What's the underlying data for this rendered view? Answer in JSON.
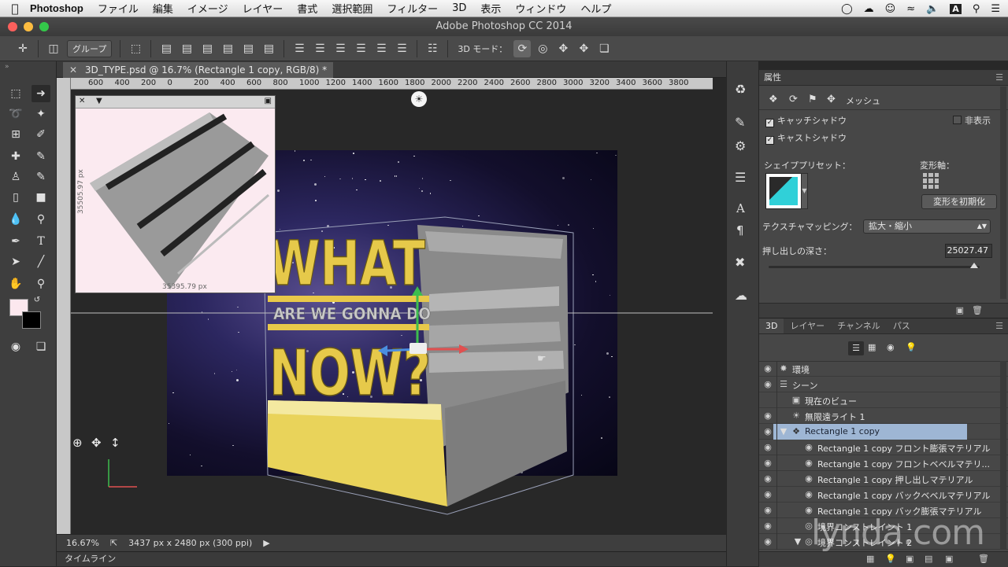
{
  "menubar": {
    "app_name": "Photoshop",
    "items": [
      "ファイル",
      "編集",
      "イメージ",
      "レイヤー",
      "書式",
      "選択範囲",
      "フィルター",
      "3D",
      "表示",
      "ウィンドウ",
      "ヘルプ"
    ],
    "status_letter": "A"
  },
  "window": {
    "title": "Adobe Photoshop CC 2014"
  },
  "options": {
    "group_select": "グループ",
    "mode_3d_label": "3D モード："
  },
  "document": {
    "tab_title": "3D_TYPE.psd @ 16.7% (Rectangle 1 copy, RGB/8) *",
    "ruler_numbers": [
      "600",
      "400",
      "200",
      "0",
      "200",
      "400",
      "600",
      "800",
      "1000",
      "1200",
      "1400",
      "1600",
      "1800",
      "2000",
      "2200",
      "2400",
      "2600",
      "2800",
      "3000",
      "3200",
      "3400",
      "3600",
      "3800"
    ],
    "nav_dim_vertical": "35505.97 px",
    "nav_dim_horizontal": "35395.79 px",
    "scene_text_line1": "WHAT",
    "scene_text_line2": "ARE WE GONNA DO",
    "scene_text_line3": "NOW?"
  },
  "status": {
    "zoom": "16.67%",
    "doc_size": "3437 px x 2480 px (300 ppi)"
  },
  "timeline": {
    "label": "タイムライン"
  },
  "properties": {
    "panel_title": "属性",
    "mesh_label": "メッシュ",
    "catch_shadow": "キャッチシャドウ",
    "catch_shadow_checked": true,
    "cast_shadow": "キャストシャドウ",
    "cast_shadow_checked": true,
    "hide_label": "非表示",
    "hide_checked": false,
    "shape_preset_label": "シェイププリセット：",
    "deform_axis_label": "変形軸：",
    "reset_deform_button": "変形を初期化",
    "texture_mapping_label": "テクスチャマッピング：",
    "texture_mapping_value": "拡大・縮小",
    "extrusion_depth_label": "押し出しの深さ：",
    "extrusion_depth_value": "25027.47"
  },
  "layers_panel": {
    "tabs": [
      "3D",
      "レイヤー",
      "チャンネル",
      "パス"
    ],
    "active_tab": "3D",
    "rows": [
      {
        "label": "環境",
        "indent": 0
      },
      {
        "label": "シーン",
        "indent": 0
      },
      {
        "label": "現在のビュー",
        "indent": 1
      },
      {
        "label": "無限遠ライト 1",
        "indent": 1
      },
      {
        "label": "Rectangle 1 copy",
        "indent": 1,
        "selected": true
      },
      {
        "label": "Rectangle 1 copy フロント膨張マテリアル",
        "indent": 2
      },
      {
        "label": "Rectangle 1 copy フロントベベルマテリ...",
        "indent": 2
      },
      {
        "label": "Rectangle 1 copy 押し出しマテリアル",
        "indent": 2
      },
      {
        "label": "Rectangle 1 copy バックベベルマテリアル",
        "indent": 2
      },
      {
        "label": "Rectangle 1 copy バック膨張マテリアル",
        "indent": 2
      },
      {
        "label": "境界コンストレイント 1",
        "indent": 2
      },
      {
        "label": "境界コンストレイント 2",
        "indent": 2
      }
    ]
  },
  "watermark": "lynda.com",
  "colors": {
    "selection": "#9eb6d4",
    "type_yellow": "#e9d35a",
    "panel_bg": "#474747"
  }
}
